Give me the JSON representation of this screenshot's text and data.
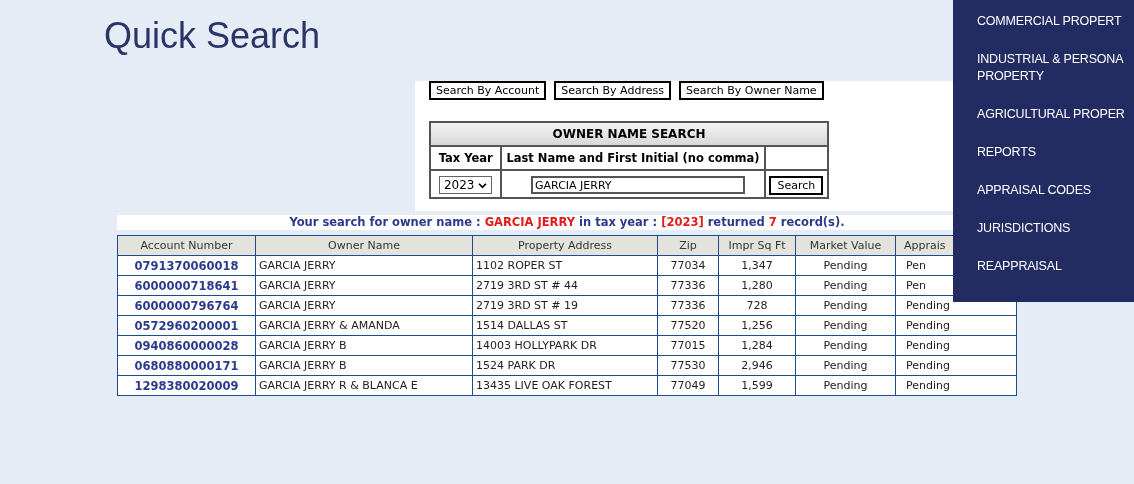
{
  "page_title": "Quick Search",
  "search_tabs": [
    {
      "label": "Search By Account"
    },
    {
      "label": "Search By Address"
    },
    {
      "label": "Search By Owner Name"
    }
  ],
  "owner_search": {
    "title": "OWNER NAME SEARCH",
    "columns": [
      "Tax Year",
      "Last Name and First Initial (no comma)"
    ],
    "tax_year": "2023",
    "name_value": "GARCIA JERRY",
    "button": "Search"
  },
  "result_message": [
    {
      "text": "Your search for owner name : ",
      "highlight": false
    },
    {
      "text": "GARCIA JERRY",
      "highlight": true
    },
    {
      "text": " in tax year : ",
      "highlight": false
    },
    {
      "text": "[2023]",
      "highlight": true
    },
    {
      "text": " returned ",
      "highlight": false
    },
    {
      "text": "7",
      "highlight": true
    },
    {
      "text": " record(s).",
      "highlight": false
    }
  ],
  "table": {
    "columns": [
      "Account Number",
      "Owner Name",
      "Property Address",
      "Zip",
      "Impr Sq Ft",
      "Market Value",
      "Apprais"
    ],
    "rows": [
      [
        "0791370060018",
        "GARCIA JERRY",
        "1102 ROPER ST",
        "77034",
        "1,347",
        "Pending",
        "Pen"
      ],
      [
        "6000000718641",
        "GARCIA JERRY",
        "2719 3RD ST # 44",
        "77336",
        "1,280",
        "Pending",
        "Pen"
      ],
      [
        "6000000796764",
        "GARCIA JERRY",
        "2719 3RD ST # 19",
        "77336",
        "728",
        "Pending",
        "Pending"
      ],
      [
        "0572960200001",
        "GARCIA JERRY & AMANDA",
        "1514 DALLAS ST",
        "77520",
        "1,256",
        "Pending",
        "Pending"
      ],
      [
        "0940860000028",
        "GARCIA JERRY B",
        "14003 HOLLYPARK DR",
        "77015",
        "1,284",
        "Pending",
        "Pending"
      ],
      [
        "0680880000171",
        "GARCIA JERRY B",
        "1524 PARK DR",
        "77530",
        "2,946",
        "Pending",
        "Pending"
      ],
      [
        "1298380020009",
        "GARCIA JERRY R & BLANCA E",
        "13435 LIVE OAK FOREST",
        "77049",
        "1,599",
        "Pending",
        "Pending"
      ]
    ]
  },
  "menu": {
    "items": [
      "COMMERCIAL PROPERT",
      "INDUSTRIAL & PERSONA\nPROPERTY",
      "AGRICULTURAL PROPER",
      "REPORTS",
      "APPRAISAL CODES",
      "JURISDICTIONS",
      "REAPPRAISAL"
    ]
  }
}
